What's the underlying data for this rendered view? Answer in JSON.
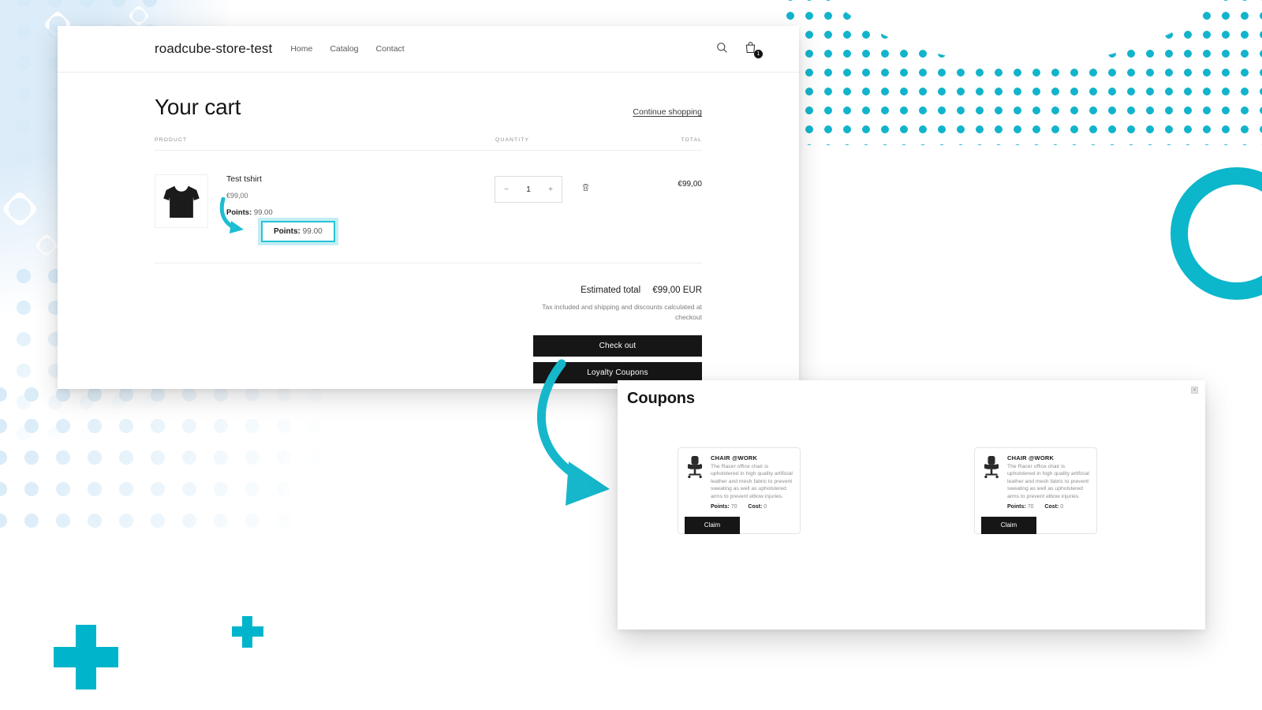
{
  "store": {
    "brand": "roadcube-store-test",
    "nav": [
      {
        "label": "Home"
      },
      {
        "label": "Catalog"
      },
      {
        "label": "Contact"
      }
    ],
    "search_icon": "search-icon",
    "cart_icon": "cart-bag-icon",
    "cart_count": "1",
    "page_title": "Your cart",
    "continue_shopping": "Continue shopping",
    "columns": {
      "product": "PRODUCT",
      "quantity": "QUANTITY",
      "total": "TOTAL"
    },
    "items": [
      {
        "thumb_icon": "tshirt-icon",
        "name": "Test tshirt",
        "price": "€99,00",
        "points_label": "Points:",
        "points_value": "99.00",
        "qty_decrease": "−",
        "qty_value": "1",
        "qty_increase": "+",
        "remove_icon": "trash-icon",
        "line_total": "€99,00"
      }
    ],
    "totals": {
      "estimated_label": "Estimated total",
      "estimated_amount": "€99,00 EUR",
      "tax_note": "Tax included and shipping and discounts calculated at checkout"
    },
    "checkout_button": "Check out",
    "loyalty_button": "Loyalty Coupons"
  },
  "callout": {
    "label": "Points:",
    "value": "99.00"
  },
  "modal": {
    "title": "Coupons",
    "close_icon": "close-icon",
    "close_label": "×",
    "coupons": [
      {
        "icon": "office-chair-icon",
        "name": "CHAIR @WORK",
        "description": "The Racer office chair is upholstered in high quality artificial leather and mesh fabric to prevent sweating as well as upholstered arms to prevent elbow injuries.",
        "points_label": "Points:",
        "points_value": "70",
        "cost_label": "Cost:",
        "cost_value": "0",
        "claim_label": "Claim"
      },
      {
        "icon": "office-chair-icon",
        "name": "CHAIR @WORK",
        "description": "The Racer office chair is upholstered in high quality artificial leather and mesh fabric to prevent sweating as well as upholstered arms to prevent elbow injuries.",
        "points_label": "Points:",
        "points_value": "70",
        "cost_label": "Cost:",
        "cost_value": "0",
        "claim_label": "Claim"
      }
    ]
  },
  "theme": {
    "accent_teal": "#00b5cb",
    "dot_teal": "#12b4cb",
    "dot_blue": "#d4e9f7",
    "dark": "#161616",
    "callout_border": "#27c3d6"
  }
}
